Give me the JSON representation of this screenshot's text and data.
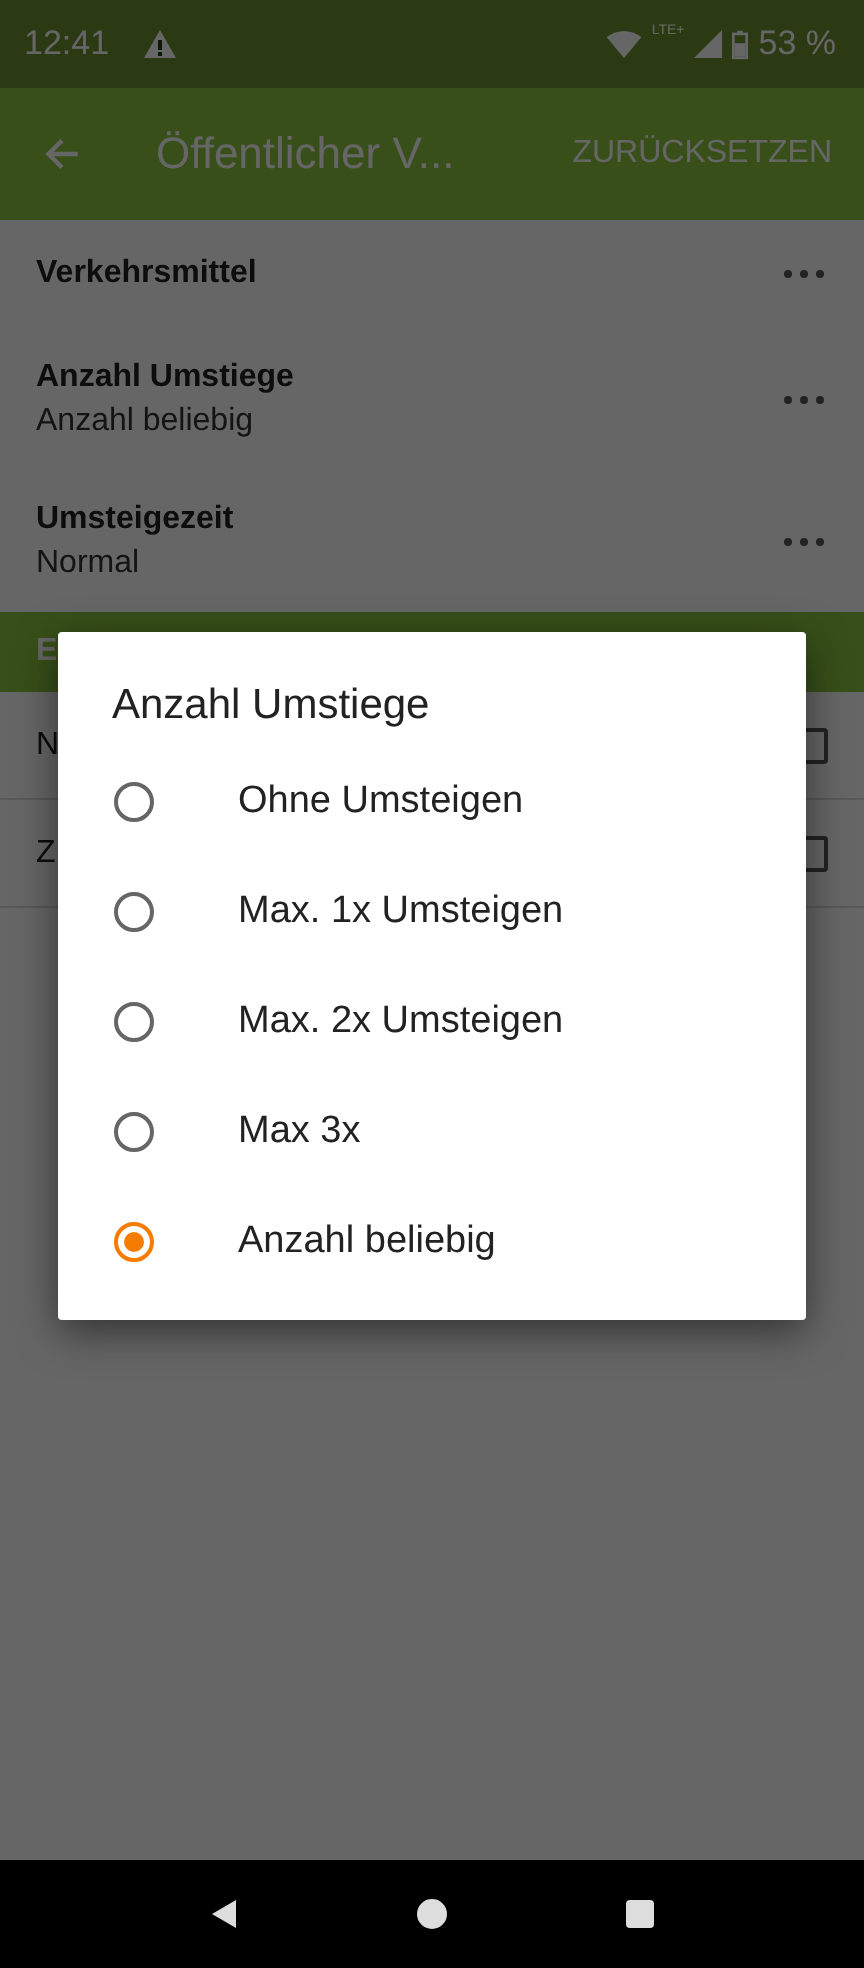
{
  "status_bar": {
    "time": "12:41",
    "network": "LTE+",
    "battery": "53 %"
  },
  "app_bar": {
    "title": "Öffentlicher V...",
    "action": "ZURÜCKSETZEN"
  },
  "settings": [
    {
      "title": "Verkehrsmittel"
    },
    {
      "title": "Anzahl Umstiege",
      "value": "Anzahl beliebig"
    },
    {
      "title": "Umsteigezeit",
      "value": "Normal"
    }
  ],
  "section": {
    "header": "E",
    "items": [
      {
        "label": "N",
        "checked": false
      },
      {
        "label": "Z",
        "checked": false
      }
    ]
  },
  "dialog": {
    "title": "Anzahl Umstiege",
    "options": [
      {
        "label": "Ohne Umsteigen",
        "selected": false
      },
      {
        "label": "Max. 1x Umsteigen",
        "selected": false
      },
      {
        "label": "Max. 2x Umsteigen",
        "selected": false
      },
      {
        "label": "Max 3x",
        "selected": false
      },
      {
        "label": "Anzahl beliebig",
        "selected": true
      }
    ]
  }
}
